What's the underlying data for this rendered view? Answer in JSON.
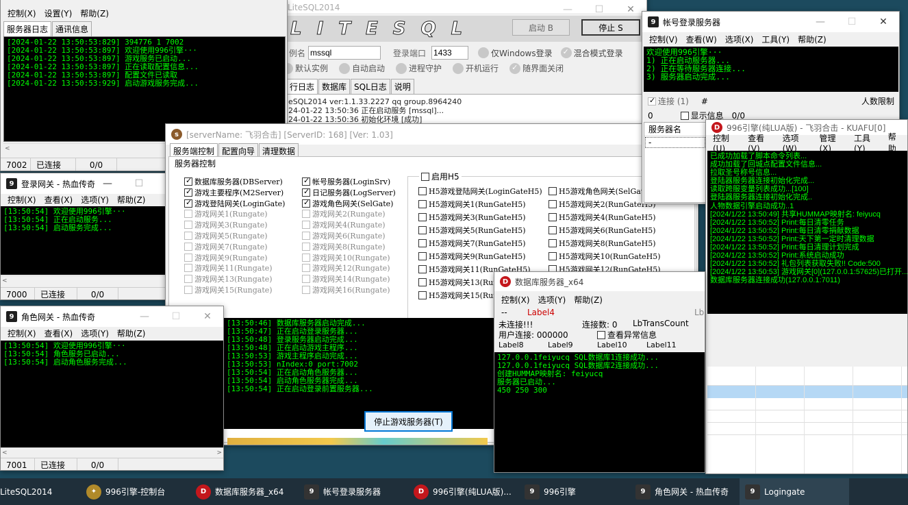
{
  "liteMain": {
    "title": "LiteSQL2014",
    "logo": "LITESQL",
    "start_btn": "启动 B",
    "stop_btn": "停止 S",
    "instance_label": "例名",
    "instance_value": "mssql",
    "port_label": "登录端口",
    "port_value": "1433",
    "opt_windows": "仅Windows登录",
    "opt_mixed": "混合模式登录",
    "opt_default": "默认实例",
    "opt_autostart": "自动启动",
    "opt_guard": "进程守护",
    "opt_boot": "开机运行",
    "opt_closewith": "随界面关闭",
    "tabs": [
      "行日志",
      "数据库",
      "SQL日志",
      "说明"
    ],
    "log": "eSQL2014 ver:1.1.33.2227 qq group.8964240\n24-01-22 13:50:36 正在启动服务 [mssql]...\n24-01-22 13:50:36 初始化环境 [成功]"
  },
  "console": {
    "menu": [
      "控制(X)",
      "设置(Y)",
      "帮助(Z)"
    ],
    "tabs": [
      "服务器日志",
      "通讯信息"
    ],
    "log": "[2024-01-22 13:50:53:829] 394776 1 7002\n[2024-01-22 13:50:53:897] 欢迎使用996引擎···\n[2024-01-22 13:50:53:897] 游戏服务已启动...\n[2024-01-22 13:50:53:897] 正在读取配置信息...\n[2024-01-22 13:50:53:897] 配置文件已读取\n[2024-01-22 13:50:53:929] 启动游戏服务完成...",
    "status": [
      "7002",
      "已连接",
      "0/0"
    ]
  },
  "loginGate": {
    "title": "登录网关 - 热血传奇",
    "menu": [
      "控制(X)",
      "查看(X)",
      "选项(Y)",
      "帮助(Z)"
    ],
    "log": "[13:50:54] 欢迎使用996引擎···\n[13:50:54] 正在启动服务...\n[13:50:54] 启动服务完成...",
    "status": [
      "7000",
      "已连接",
      "0/0"
    ]
  },
  "roleGate": {
    "title": "角色网关 - 热血传奇",
    "menu": [
      "控制(X)",
      "查看(X)",
      "选项(Y)",
      "帮助(Z)"
    ],
    "log": "[13:50:54] 欢迎使用996引擎···\n[13:50:54] 角色服务已启动...\n[13:50:54] 启动角色服务完成...",
    "status": [
      "7001",
      "已连接",
      "0/0"
    ]
  },
  "serverCtl": {
    "title": "[serverName: 飞羽合击] [ServerID: 168] [Ver: 1.03]",
    "tabs": [
      "服务端控制",
      "配置向导",
      "清理数据"
    ],
    "group_label": "服务器控制",
    "col1": [
      "数据库服务器(DBServer)",
      "游戏主要程序(M2Server)",
      "游戏登陆网关(LoginGate)",
      "游戏网关1(Rungate)",
      "游戏网关3(Rungate)",
      "游戏网关5(Rungate)",
      "游戏网关7(Rungate)",
      "游戏网关9(Rungate)",
      "游戏网关11(Rungate)",
      "游戏网关13(Rungate)",
      "游戏网关15(Rungate)"
    ],
    "col2": [
      "帐号服务器(LoginSrv)",
      "日记服务器(LogServer)",
      "游戏角色网关(SelGate)",
      "游戏网关2(Rungate)",
      "游戏网关4(Rungate)",
      "游戏网关6(Rungate)",
      "游戏网关8(Rungate)",
      "游戏网关10(Rungate)",
      "游戏网关12(Rungate)",
      "游戏网关14(Rungate)",
      "游戏网关16(Rungate)"
    ],
    "h5_enable": "启用H5",
    "h5col1": [
      "H5游戏登陆网关(LoginGateH5)",
      "H5游戏网关1(RunGateH5)",
      "H5游戏网关3(RunGateH5)",
      "H5游戏网关5(RunGateH5)",
      "H5游戏网关7(RunGateH5)",
      "H5游戏网关9(RunGateH5)",
      "H5游戏网关11(RunGateH5)",
      "H5游戏网关13(RunGateH5)",
      "H5游戏网关15(RunGateH5)"
    ],
    "h5col2": [
      "H5游戏角色网关(SelGateH5)",
      "H5游戏网关2(RunGateH5)",
      "H5游戏网关4(RunGateH5)",
      "H5游戏网关6(RunGateH5)",
      "H5游戏网关8(RunGateH5)",
      "H5游戏网关10(RunGateH5)",
      "H5游戏网关12(RunGateH5)"
    ],
    "log": "[13:50:46] 数据库服务器启动完成...\n[13:50:47] 正在启动登录服务器...\n[13:50:48] 登录服务器启动完成...\n[13:50:48] 正在启动游戏主程序...\n[13:50:53] 游戏主程序启动完成...\n[13:50:53] nIndex:0 port:7002\n[13:50:54] 正在启动角色服务器...\n[13:50:54] 启动角色服务器完成...\n[13:50:54] 正在启动登录前置服务器...",
    "stop_button": "停止游戏服务器(T)"
  },
  "accountSrv": {
    "title": "帐号登录服务器",
    "menu": [
      "控制(V)",
      "查看(W)",
      "选项(X)",
      "工具(Y)",
      "帮助(Z)"
    ],
    "log": "欢迎使用996引擎···\n1) 正在启动服务器...\n2) 正在等待服务器连接...\n3) 服务器启动完成...",
    "connect_label": "连接 (1)",
    "hash": "#",
    "limit_label": "人数限制",
    "zero": "0",
    "show_info": "显示信息",
    "ratio": "0/0",
    "server_name_col": "服务器名",
    "dash": "-"
  },
  "dbServer": {
    "title": "数据库服务器_x64",
    "menu": [
      "控制(X)",
      "选项(Y)",
      "帮助(Z)"
    ],
    "dashdash": "--",
    "label4": "Label4",
    "lbx": "Lb",
    "not_connected": "未连接!!!",
    "conn_count": "连接数: 0",
    "lbtrans": "LbTransCount",
    "user_conn": "用户连接: 000000",
    "check_err": "查看异常信息",
    "labels": [
      "Label8",
      "Label9",
      "Label10",
      "Label11"
    ],
    "log": "127.0.0.1feiyucq SQL数据库1连接成功...\n127.0.0.1feiyucq SQL数据库2连接成功...\n创建HUMMAP映射名: feiyucq\n服务器已启动...\n450 250 300"
  },
  "engine": {
    "title": "996引擎(纯LUA版) - 飞羽合击 - KUAFU[0]",
    "menu": [
      "控制(U)",
      "查看(V)",
      "选项(W)",
      "管理(X)",
      "工具(Y)",
      "帮助"
    ],
    "log": "已成功加载了脚本命令列表...\n成功加载了回城点配置文件信息...\n拉取圣号称号信息...\n登陆器服务器连接初始化完成...\n读取跨服变量列表成功...[100]\n登陆器服务器连接初始化完成..\n人物数据引擎启动成功..1\n[2024/1/22 13:50:49] 共享HUMMAP映射名: feiyucq\n[2024/1/22 13:50:52] Print:每日清零任务\n[2024/1/22 13:50:52] Print:每日清零捐献数据\n[2024/1/22 13:50:52] Print:天下第一定时清理数据\n[2024/1/22 13:50:52] Print:每日清理计划完成\n[2024/1/22 13:50:52] Print:系统启动成功\n[2024/1/22 13:50:52] 礼包列表获取失败!! Code:500\n[2024/1/22 13:50:53] 游戏网关[0](127.0.0.1:57625)已打开...\n数据库服务器连接成功(127.0.0.1:7011)"
  },
  "taskbar": {
    "items": [
      "LiteSQL2014",
      "996引擎-控制台",
      "数据库服务器_x64",
      "帐号登录服务器",
      "996引擎(纯LUA版)...",
      "996引擎",
      "角色网关 - 热血传奇",
      "Logingate"
    ]
  }
}
